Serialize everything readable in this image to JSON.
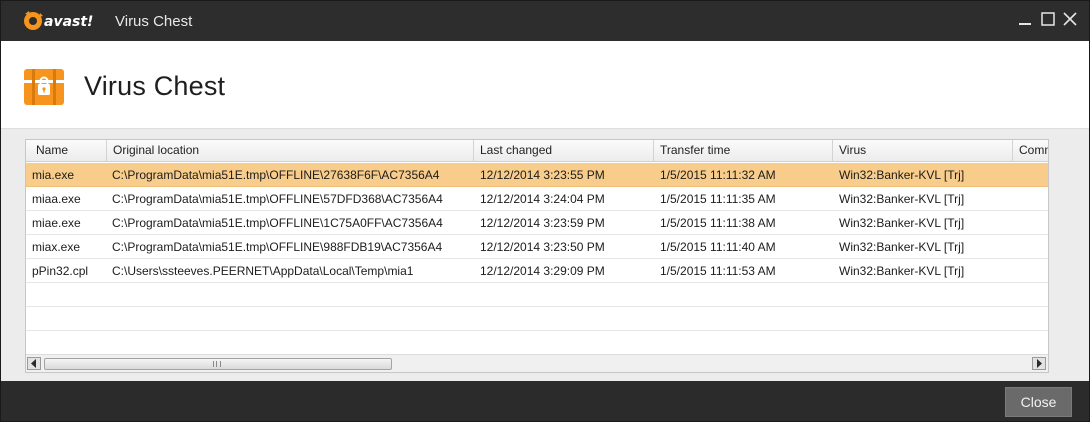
{
  "window": {
    "brand": "avast!",
    "title": "Virus Chest"
  },
  "header": {
    "title": "Virus Chest"
  },
  "table": {
    "columns": [
      "Name",
      "Original location",
      "Last changed",
      "Transfer time",
      "Virus",
      "Comm"
    ],
    "rows": [
      [
        "mia.exe",
        "C:\\ProgramData\\mia51E.tmp\\OFFLINE\\27638F6F\\AC7356A4",
        "12/12/2014 3:23:55 PM",
        "1/5/2015 11:11:32 AM",
        "Win32:Banker-KVL [Trj]"
      ],
      [
        "miaa.exe",
        "C:\\ProgramData\\mia51E.tmp\\OFFLINE\\57DFD368\\AC7356A4",
        "12/12/2014 3:24:04 PM",
        "1/5/2015 11:11:35 AM",
        "Win32:Banker-KVL [Trj]"
      ],
      [
        "miae.exe",
        "C:\\ProgramData\\mia51E.tmp\\OFFLINE\\1C75A0FF\\AC7356A4",
        "12/12/2014 3:23:59 PM",
        "1/5/2015 11:11:38 AM",
        "Win32:Banker-KVL [Trj]"
      ],
      [
        "miax.exe",
        "C:\\ProgramData\\mia51E.tmp\\OFFLINE\\988FDB19\\AC7356A4",
        "12/12/2014 3:23:50 PM",
        "1/5/2015 11:11:40 AM",
        "Win32:Banker-KVL [Trj]"
      ],
      [
        "pPin32.cpl",
        "C:\\Users\\ssteeves.PEERNET\\AppData\\Local\\Temp\\mia1",
        "12/12/2014 3:29:09 PM",
        "1/5/2015 11:11:53 AM",
        "Win32:Banker-KVL [Trj]"
      ]
    ],
    "selected_row": 0
  },
  "footer": {
    "close_label": "Close"
  },
  "icons": {
    "minimize": "minimize-icon",
    "maximize": "maximize-icon",
    "close": "close-icon",
    "chest": "chest-lock-icon",
    "scroll_left": "arrow-left-icon",
    "scroll_right": "arrow-right-icon"
  },
  "colors": {
    "accent": "#f7941d",
    "selection": "#f8cc8a",
    "titlebar": "#2d2d2d"
  }
}
